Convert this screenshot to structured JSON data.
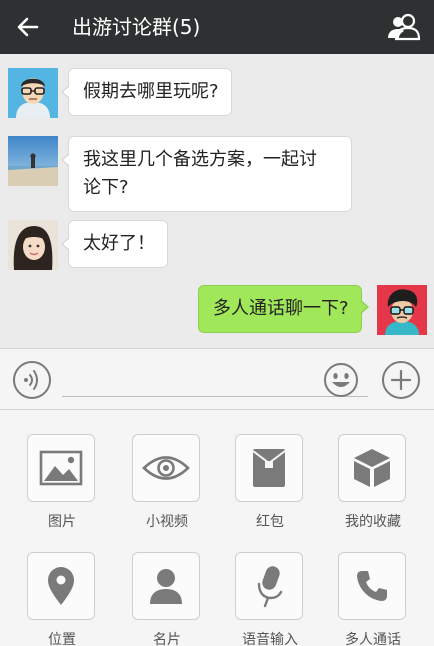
{
  "header": {
    "title": "出游讨论群(5)"
  },
  "messages": [
    {
      "side": "left",
      "text": "假期去哪里玩呢?"
    },
    {
      "side": "left",
      "line1": "我这里几个备选方案，一起讨",
      "line2": "论下?"
    },
    {
      "side": "left",
      "text": "太好了！"
    },
    {
      "side": "right",
      "text": "多人通话聊一下?"
    }
  ],
  "tools": [
    {
      "label": "图片",
      "icon": "image-icon"
    },
    {
      "label": "小视频",
      "icon": "eye-icon"
    },
    {
      "label": "红包",
      "icon": "red-packet-icon"
    },
    {
      "label": "我的收藏",
      "icon": "favorites-cube-icon"
    },
    {
      "label": "位置",
      "icon": "location-pin-icon"
    },
    {
      "label": "名片",
      "icon": "contact-card-icon"
    },
    {
      "label": "语音输入",
      "icon": "microphone-icon"
    },
    {
      "label": "多人通话",
      "icon": "phone-icon"
    }
  ],
  "colors": {
    "topbar": "#2e3132",
    "chat_bg": "#ebebeb",
    "my_bubble": "#a0e759",
    "icon_gray": "#7a7a7a"
  }
}
